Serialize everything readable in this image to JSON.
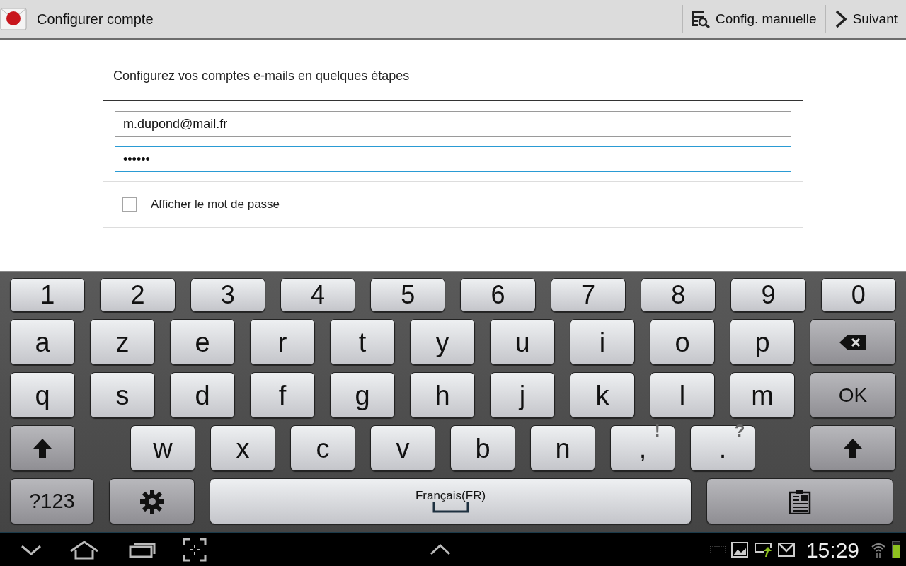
{
  "action_bar": {
    "title": "Configurer compte",
    "actions": [
      {
        "kind": "manual",
        "label": "Config. manuelle"
      },
      {
        "kind": "next",
        "label": "Suivant"
      }
    ]
  },
  "heading": "Configurez vos comptes e-mails en quelques étapes",
  "fields": [
    {
      "value": "m.dupond@mail.fr",
      "focused": false
    },
    {
      "value": "••••••",
      "focused": true
    }
  ],
  "show_password": {
    "label": "Afficher le mot de passe",
    "checked": false
  },
  "keyboard": {
    "rows": [
      {
        "kind": "numbers",
        "keys": [
          {
            "kind": "char",
            "label": "1"
          },
          {
            "kind": "char",
            "label": "2"
          },
          {
            "kind": "char",
            "label": "3"
          },
          {
            "kind": "char",
            "label": "4"
          },
          {
            "kind": "char",
            "label": "5"
          },
          {
            "kind": "char",
            "label": "6"
          },
          {
            "kind": "char",
            "label": "7"
          },
          {
            "kind": "char",
            "label": "8"
          },
          {
            "kind": "char",
            "label": "9"
          },
          {
            "kind": "char",
            "label": "0"
          }
        ]
      },
      {
        "kind": "letters",
        "keys": [
          {
            "kind": "char",
            "label": "a"
          },
          {
            "kind": "char",
            "label": "z"
          },
          {
            "kind": "char",
            "label": "e"
          },
          {
            "kind": "char",
            "label": "r"
          },
          {
            "kind": "char",
            "label": "t"
          },
          {
            "kind": "char",
            "label": "y"
          },
          {
            "kind": "char",
            "label": "u"
          },
          {
            "kind": "char",
            "label": "i"
          },
          {
            "kind": "char",
            "label": "o"
          },
          {
            "kind": "char",
            "label": "p"
          },
          {
            "kind": "backspace"
          }
        ]
      },
      {
        "kind": "letters",
        "keys": [
          {
            "kind": "char",
            "label": "q"
          },
          {
            "kind": "char",
            "label": "s"
          },
          {
            "kind": "char",
            "label": "d"
          },
          {
            "kind": "char",
            "label": "f"
          },
          {
            "kind": "char",
            "label": "g"
          },
          {
            "kind": "char",
            "label": "h"
          },
          {
            "kind": "char",
            "label": "j"
          },
          {
            "kind": "char",
            "label": "k"
          },
          {
            "kind": "char",
            "label": "l"
          },
          {
            "kind": "char",
            "label": "m"
          },
          {
            "kind": "enter",
            "label": "OK"
          }
        ]
      },
      {
        "kind": "shifted",
        "keys": [
          {
            "kind": "shift"
          },
          {
            "kind": "char",
            "label": "w"
          },
          {
            "kind": "char",
            "label": "x"
          },
          {
            "kind": "char",
            "label": "c"
          },
          {
            "kind": "char",
            "label": "v"
          },
          {
            "kind": "char",
            "label": "b"
          },
          {
            "kind": "char",
            "label": "n"
          },
          {
            "kind": "punct",
            "label": ",",
            "alt": "!"
          },
          {
            "kind": "punct",
            "label": ".",
            "alt": "?"
          },
          {
            "kind": "shift"
          }
        ]
      },
      {
        "kind": "bottom",
        "keys": [
          {
            "kind": "symbols",
            "label": "?123"
          },
          {
            "kind": "settings"
          },
          {
            "kind": "space",
            "label": "Français(FR)"
          },
          {
            "kind": "clipboard"
          }
        ]
      }
    ]
  },
  "status_bar": {
    "time": "15:29",
    "battery": {
      "level": 0.8
    }
  }
}
